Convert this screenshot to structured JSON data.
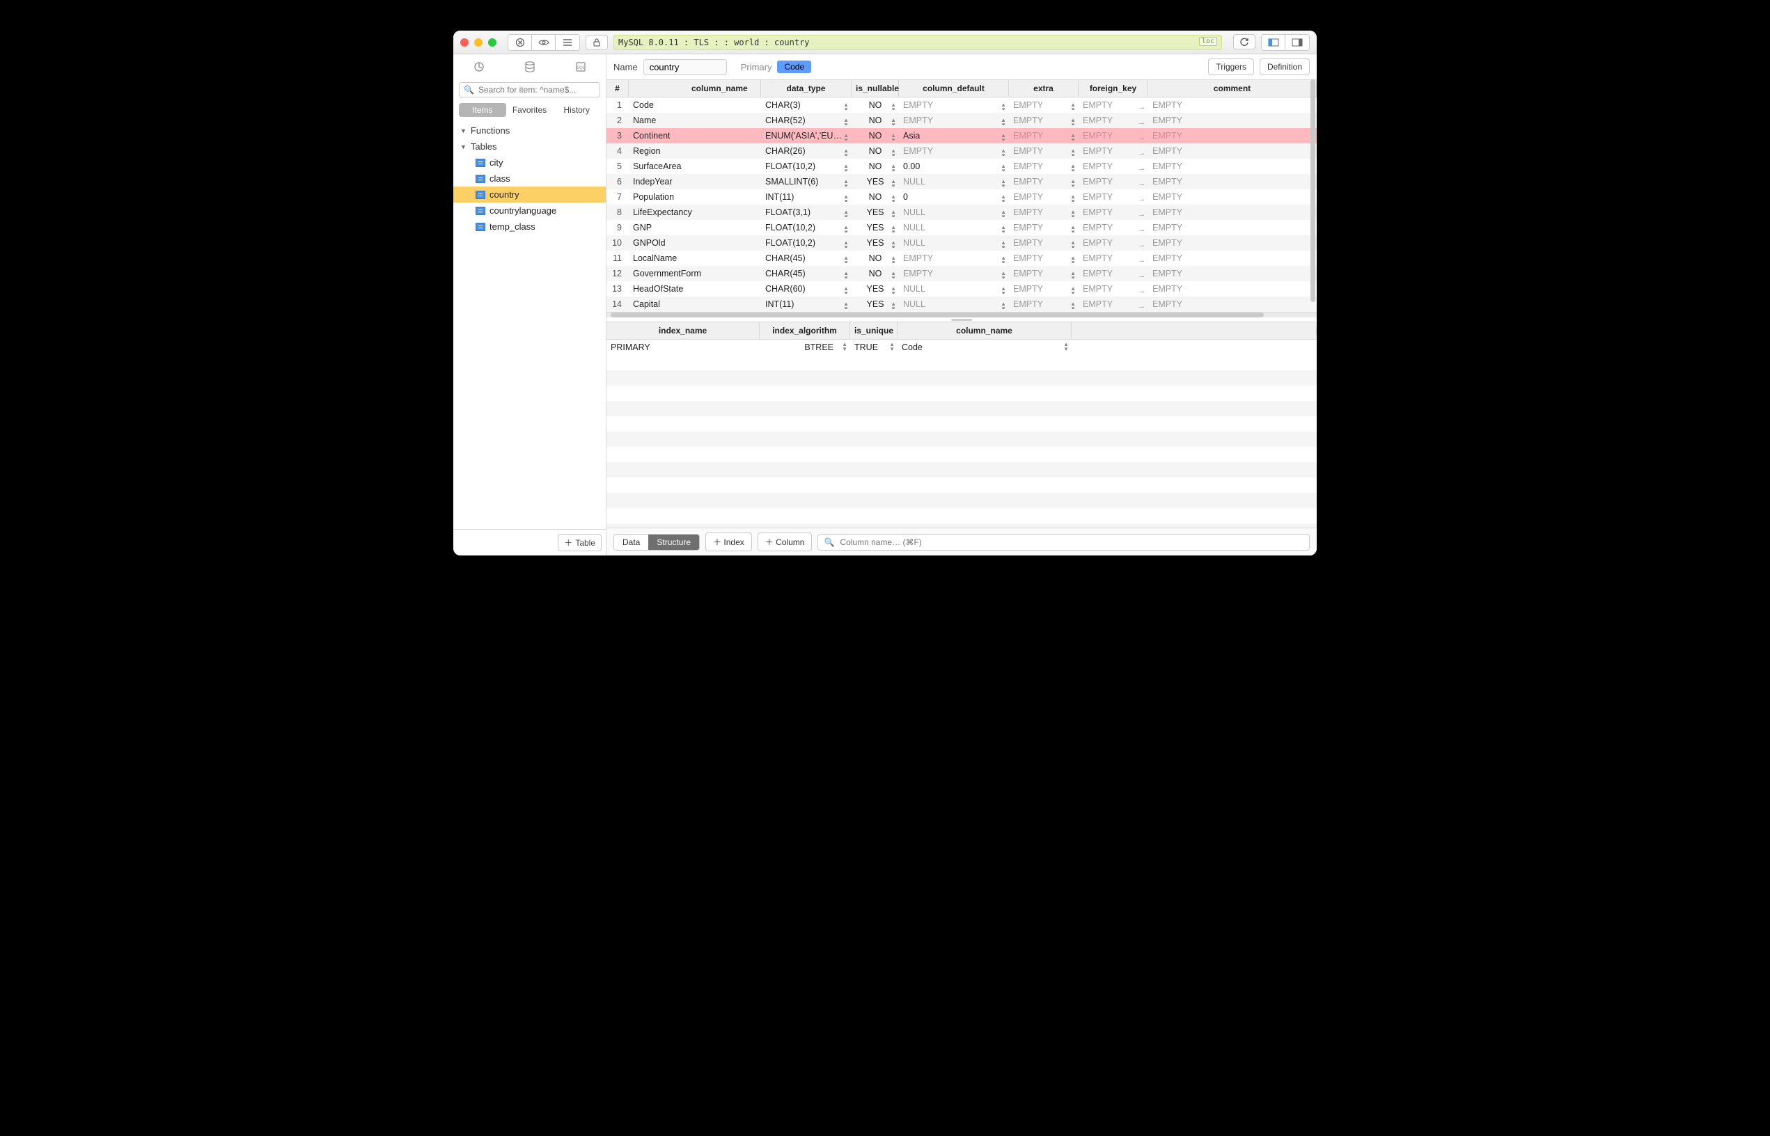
{
  "titlebar": {
    "breadcrumb": "MySQL 8.0.11 : TLS :  : world : country",
    "loc_badge": "loc"
  },
  "sidebar": {
    "search_placeholder": "Search for item: ^name$...",
    "seg": {
      "items": "Items",
      "favorites": "Favorites",
      "history": "History"
    },
    "sections": {
      "functions": "Functions",
      "tables": "Tables"
    },
    "tables": [
      "city",
      "class",
      "country",
      "countrylanguage",
      "temp_class"
    ],
    "selected_table": "country",
    "add_table_label": "Table"
  },
  "name_bar": {
    "label": "Name",
    "value": "country",
    "primary_label": "Primary",
    "primary_value": "Code",
    "triggers": "Triggers",
    "definition": "Definition"
  },
  "columns_header": {
    "num": "#",
    "name": "column_name",
    "type": "data_type",
    "nullable": "is_nullable",
    "default": "column_default",
    "extra": "extra",
    "fk": "foreign_key",
    "comment": "comment"
  },
  "columns": [
    {
      "n": 1,
      "name": "Code",
      "type": "CHAR(3)",
      "nullable": "NO",
      "default": "EMPTY",
      "extra": "EMPTY",
      "fk": "EMPTY",
      "comment": "EMPTY"
    },
    {
      "n": 2,
      "name": "Name",
      "type": "CHAR(52)",
      "nullable": "NO",
      "default": "EMPTY",
      "extra": "EMPTY",
      "fk": "EMPTY",
      "comment": "EMPTY"
    },
    {
      "n": 3,
      "name": "Continent",
      "type": "ENUM('ASIA','EUR…",
      "nullable": "NO",
      "default": "Asia",
      "extra": "EMPTY",
      "fk": "EMPTY",
      "comment": "EMPTY",
      "selected": true
    },
    {
      "n": 4,
      "name": "Region",
      "type": "CHAR(26)",
      "nullable": "NO",
      "default": "EMPTY",
      "extra": "EMPTY",
      "fk": "EMPTY",
      "comment": "EMPTY"
    },
    {
      "n": 5,
      "name": "SurfaceArea",
      "type": "FLOAT(10,2)",
      "nullable": "NO",
      "default": "0.00",
      "extra": "EMPTY",
      "fk": "EMPTY",
      "comment": "EMPTY"
    },
    {
      "n": 6,
      "name": "IndepYear",
      "type": "SMALLINT(6)",
      "nullable": "YES",
      "default": "NULL",
      "extra": "EMPTY",
      "fk": "EMPTY",
      "comment": "EMPTY"
    },
    {
      "n": 7,
      "name": "Population",
      "type": "INT(11)",
      "nullable": "NO",
      "default": "0",
      "extra": "EMPTY",
      "fk": "EMPTY",
      "comment": "EMPTY"
    },
    {
      "n": 8,
      "name": "LifeExpectancy",
      "type": "FLOAT(3,1)",
      "nullable": "YES",
      "default": "NULL",
      "extra": "EMPTY",
      "fk": "EMPTY",
      "comment": "EMPTY"
    },
    {
      "n": 9,
      "name": "GNP",
      "type": "FLOAT(10,2)",
      "nullable": "YES",
      "default": "NULL",
      "extra": "EMPTY",
      "fk": "EMPTY",
      "comment": "EMPTY"
    },
    {
      "n": 10,
      "name": "GNPOld",
      "type": "FLOAT(10,2)",
      "nullable": "YES",
      "default": "NULL",
      "extra": "EMPTY",
      "fk": "EMPTY",
      "comment": "EMPTY"
    },
    {
      "n": 11,
      "name": "LocalName",
      "type": "CHAR(45)",
      "nullable": "NO",
      "default": "EMPTY",
      "extra": "EMPTY",
      "fk": "EMPTY",
      "comment": "EMPTY"
    },
    {
      "n": 12,
      "name": "GovernmentForm",
      "type": "CHAR(45)",
      "nullable": "NO",
      "default": "EMPTY",
      "extra": "EMPTY",
      "fk": "EMPTY",
      "comment": "EMPTY"
    },
    {
      "n": 13,
      "name": "HeadOfState",
      "type": "CHAR(60)",
      "nullable": "YES",
      "default": "NULL",
      "extra": "EMPTY",
      "fk": "EMPTY",
      "comment": "EMPTY"
    },
    {
      "n": 14,
      "name": "Capital",
      "type": "INT(11)",
      "nullable": "YES",
      "default": "NULL",
      "extra": "EMPTY",
      "fk": "EMPTY",
      "comment": "EMPTY"
    }
  ],
  "index_header": {
    "name": "index_name",
    "alg": "index_algorithm",
    "unique": "is_unique",
    "col": "column_name"
  },
  "indexes": [
    {
      "name": "PRIMARY",
      "alg": "BTREE",
      "unique": "TRUE",
      "col": "Code"
    }
  ],
  "bottom": {
    "data": "Data",
    "structure": "Structure",
    "add_index": "Index",
    "add_column": "Column",
    "filter_placeholder": "Column name… (⌘F)"
  }
}
